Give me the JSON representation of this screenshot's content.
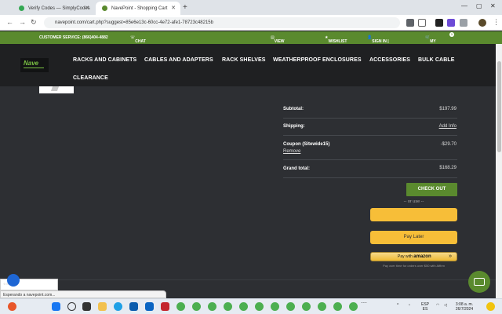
{
  "browser": {
    "tabs": [
      {
        "title": "Verify Codes — SimplyCodes",
        "favicon_color": "#34a853"
      },
      {
        "title": "NavePoint - Shopping Cart",
        "favicon_color": "#5a8a2e",
        "active": true
      }
    ],
    "url": "navepoint.com/cart.php?suggest=85e6e13c-60cc-4e72-afe1-78723c48215b",
    "window_controls": [
      "—",
      "▢",
      "✕"
    ]
  },
  "topbar": {
    "customer_service": "CUSTOMER SERVICE: (866)404-4882",
    "chat": "CHAT WITH US NOW",
    "view_quotes": "VIEW QUOTE(S)",
    "wishlist": "WISHLIST",
    "signin": "SIGN IN | REGISTER",
    "my_cart": "MY CART",
    "cart_count": "1"
  },
  "logo": {
    "text": "Nave"
  },
  "nav": [
    "RACKS AND CABINETS",
    "CABLES AND ADAPTERS",
    "RACK SHELVES",
    "WEATHERPROOF ENCLOSURES",
    "ACCESSORIES",
    "BULK CABLE",
    "CLEARANCE"
  ],
  "summary": {
    "subtotal_label": "Subtotal:",
    "subtotal_value": "$197.99",
    "shipping_label": "Shipping:",
    "shipping_value": "Add Info",
    "coupon_label": "Coupon (Sitewide15)",
    "coupon_remove": "Remove",
    "coupon_value": "-$29.70",
    "grand_total_label": "Grand total:",
    "grand_total_value": "$168.29"
  },
  "checkout": {
    "button": "CHECK OUT",
    "or_use": "-- or use --",
    "paylater": "Pay Later",
    "amazon": "Pay with",
    "amazon_brand": "amazon",
    "amazon_note": "Pay over time for orders over $50 with Affirm"
  },
  "status": {
    "text": "Esperando a navepoint.com..."
  },
  "reviews": {
    "text": "☆☆☆☆☆"
  },
  "taskbar": {
    "lang": "ESP\nES",
    "time": "3:08 a. m.",
    "date": "26/7/2024"
  }
}
